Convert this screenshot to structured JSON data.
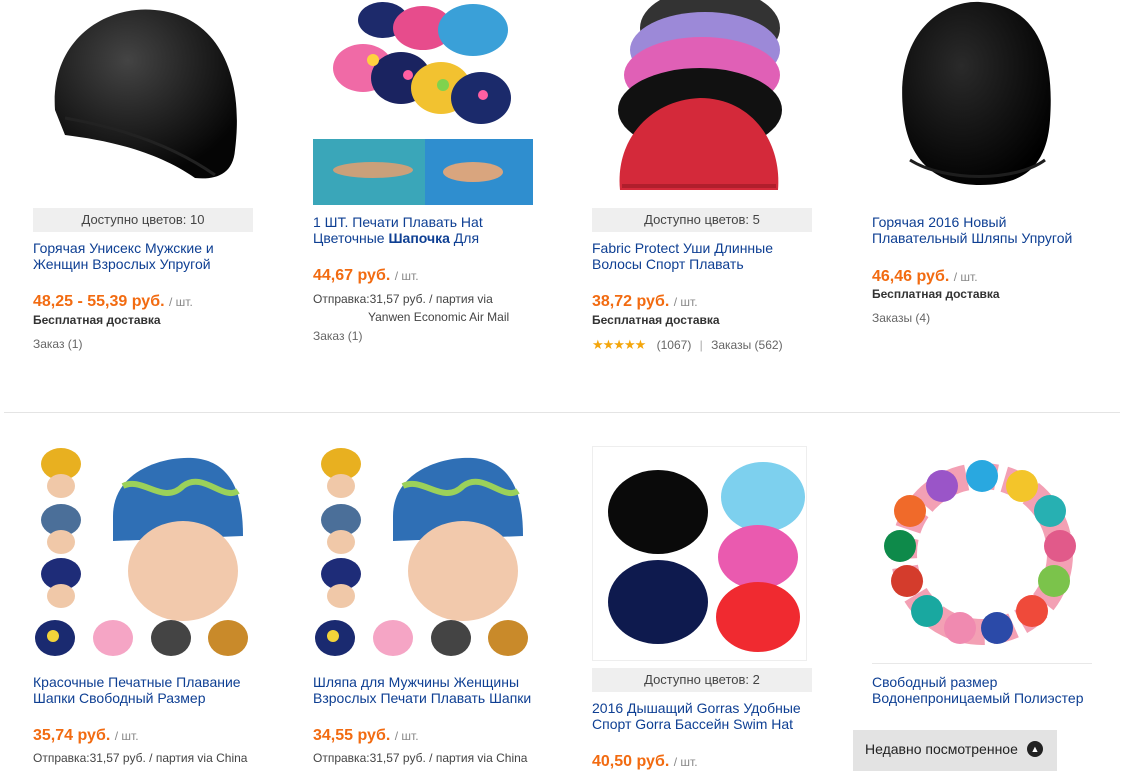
{
  "products": [
    {
      "colors_available": "Доступно цветов: 10",
      "title": "Горячая Унисекс Мужские и Женщин Взрослых Упругой",
      "price": "48,25 - 55,39 руб.",
      "unit": "/ шт.",
      "shipping": "Бесплатная доставка",
      "orders": "Заказ (1)"
    },
    {
      "title_part1": "1 ШТ. Печати Плавать Hat Цветочные ",
      "title_highlight": "Шапочка",
      "title_part2": " Для",
      "price": "44,67 руб.",
      "unit": "/ шт.",
      "shipping_line1": "Отправка:31,57 руб. / партия via",
      "shipping_line2": "Yanwen Economic Air Mail",
      "orders": "Заказ (1)"
    },
    {
      "colors_available": "Доступно цветов: 5",
      "title": "Fabric Protect Уши Длинные Волосы Спорт Плавать",
      "price": "38,72 руб.",
      "unit": "/ шт.",
      "shipping": "Бесплатная доставка",
      "rating_stars": "★★★★★",
      "rating_count": "(1067)",
      "divider": "|",
      "orders": "Заказы (562)"
    },
    {
      "title": "Горячая 2016 Новый Плавательный Шляпы Упругой",
      "price": "46,46 руб.",
      "unit": "/ шт.",
      "shipping": "Бесплатная доставка",
      "orders": "Заказы (4)"
    },
    {
      "title": "Красочные Печатные Плавание Шапки Свободный Размер",
      "price": "35,74 руб.",
      "unit": "/ шт.",
      "shipping_line1": "Отправка:31,57 руб. / партия via China"
    },
    {
      "title": "Шляпа для Мужчины Женщины Взрослых Печати Плавать Шапки",
      "price": "34,55 руб.",
      "unit": "/ шт.",
      "shipping_line1": "Отправка:31,57 руб. / партия via China"
    },
    {
      "colors_available": "Доступно цветов: 2",
      "title": "2016 Дышащий Gorras Удобные Спорт Gorra Бассейн Swim Hat",
      "price": "40,50 руб.",
      "unit": "/ шт."
    },
    {
      "title": "Свободный размер Водонепроницаемый Полиэстер"
    }
  ],
  "recently_viewed": {
    "label": "Недавно посмотренное",
    "icon": "chevron-up-icon"
  },
  "colors": {
    "price": "#f26b11",
    "link": "#0e3f93",
    "badge_bg": "#efefef",
    "star": "#f4a60c"
  }
}
